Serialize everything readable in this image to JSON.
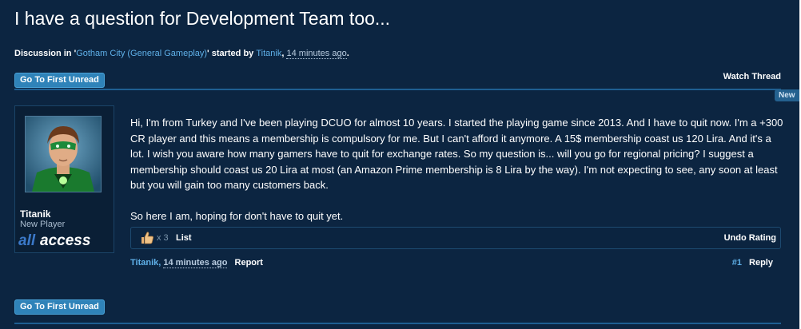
{
  "thread": {
    "title": "I have a question for Development Team too...",
    "discussion_prefix": "Discussion in '",
    "forum_name": "Gotham City (General Gameplay)",
    "started_by_text": "' started by ",
    "author": "Titanik",
    "comma": ", ",
    "time_ago": "14 minutes ago",
    "period": "."
  },
  "buttons": {
    "first_unread_top": "Go To First Unread",
    "first_unread_bottom": "Go To First Unread",
    "watch_thread": "Watch Thread"
  },
  "post": {
    "new_tag": "New",
    "user": {
      "name": "Titanik",
      "title": "New Player",
      "badge": "allaccess"
    },
    "paragraph1": "Hi, I'm from Turkey and I've been playing DCUO for almost 10 years. I started the playing game since 2013. And I have to quit now. I'm a +300 CR player and this means a membership is compulsory for me. But I can't afford it anymore. A 15$ membership coast us 120 Lira. And it's a lot. I wish you aware how many gamers have to quit for exchange rates. So my question is... will you go for regional pricing? I suggest a membership should coast us 20 Lira at most (an Amazon Prime membership is 8 Lira by the way). I'm not expecting to see, any soon at least but you will gain too many customers back.",
    "paragraph2": "So here I am, hoping for don't have to quit yet.",
    "ratings": {
      "icon": "thumbs-up-icon",
      "count": "x 3",
      "list_label": "List",
      "undo_label": "Undo Rating"
    },
    "meta": {
      "author": "Titanik",
      "comma": ", ",
      "time_ago": "14 minutes ago",
      "report_label": "Report",
      "post_number": "#1",
      "reply_label": "Reply"
    }
  },
  "colors": {
    "background": "#0c2541",
    "link": "#5fb0e8",
    "button": "#2f83b9",
    "rule": "#1f5f92"
  }
}
